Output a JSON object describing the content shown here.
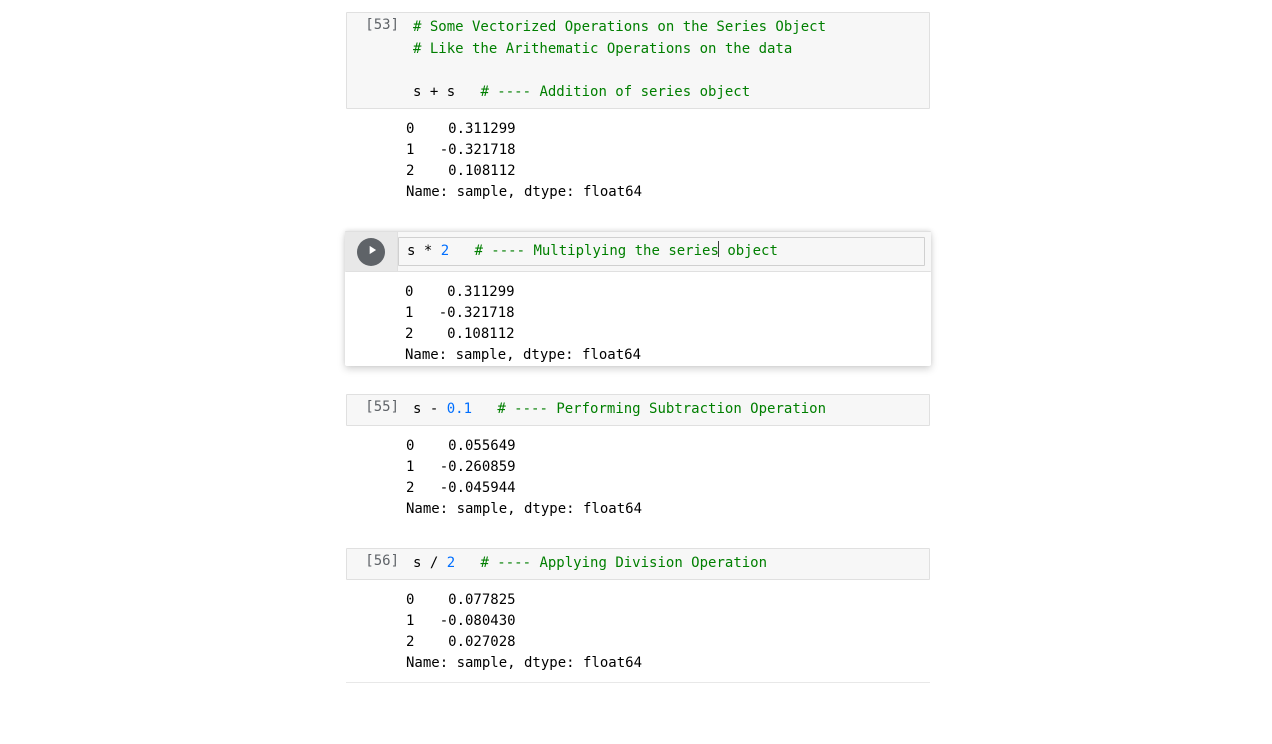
{
  "cells": [
    {
      "prompt": "[53]",
      "code": {
        "comment1": "# Some Vectorized Operations on the Series Object",
        "comment2": "# Like the Arithematic Operations on the data",
        "blank": "",
        "expr_pre": "s + s   ",
        "expr_comment": "# ---- Addition of series object"
      },
      "output": "0    0.311299\n1   -0.321718\n2    0.108112\nName: sample, dtype: float64"
    },
    {
      "code": {
        "expr_pre": "s * ",
        "expr_num": "2",
        "expr_mid": "   ",
        "expr_comment_a": "# ---- Multiplying the series",
        "expr_comment_b": " object"
      },
      "output": "0    0.311299\n1   -0.321718\n2    0.108112\nName: sample, dtype: float64"
    },
    {
      "prompt": "[55]",
      "code": {
        "expr_pre": "s - ",
        "expr_num": "0.1",
        "expr_mid": "   ",
        "expr_comment": "# ---- Performing Subtraction Operation"
      },
      "output": "0    0.055649\n1   -0.260859\n2   -0.045944\nName: sample, dtype: float64"
    },
    {
      "prompt": "[56]",
      "code": {
        "expr_pre": "s / ",
        "expr_num": "2",
        "expr_mid": "   ",
        "expr_comment": "# ---- Applying Division Operation"
      },
      "output": "0    0.077825\n1   -0.080430\n2    0.027028\nName: sample, dtype: float64"
    }
  ]
}
